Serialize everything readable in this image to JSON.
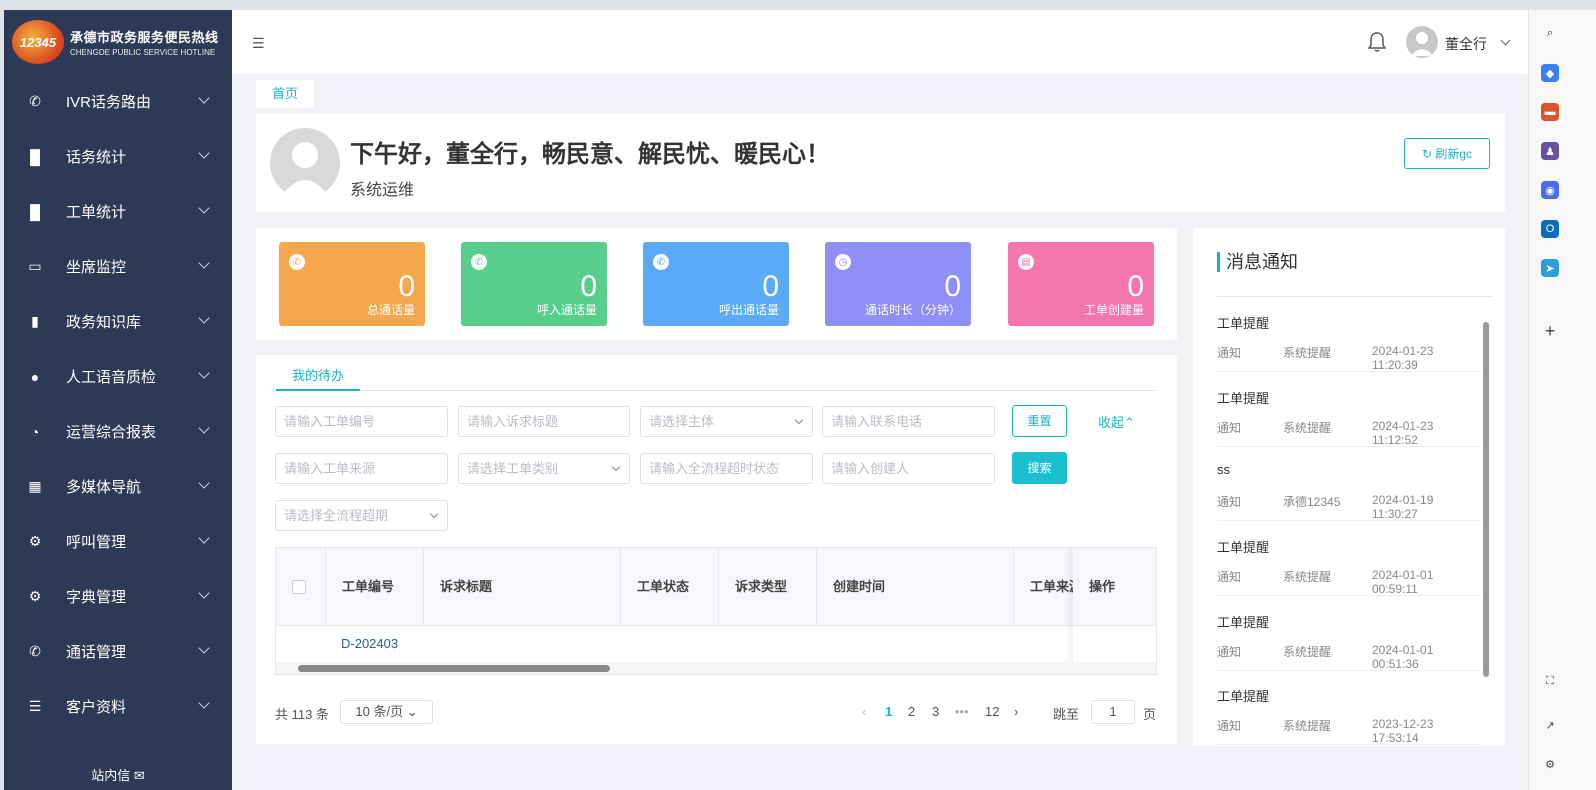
{
  "logo": {
    "mark": "12345",
    "title": "承德市政务服务便民热线",
    "subtitle": "CHENGDE PUBLIC SERVICE HOTLINE"
  },
  "sidebar": {
    "items": [
      {
        "label": "IVR话务路由",
        "icon": "phone-icon"
      },
      {
        "label": "话务统计",
        "icon": "bar-chart-icon"
      },
      {
        "label": "工单统计",
        "icon": "bar-chart-icon"
      },
      {
        "label": "坐席监控",
        "icon": "monitor-icon"
      },
      {
        "label": "政务知识库",
        "icon": "book-icon"
      },
      {
        "label": "人工语音质检",
        "icon": "user-icon"
      },
      {
        "label": "运营综合报表",
        "icon": "pie-chart-icon"
      },
      {
        "label": "多媒体导航",
        "icon": "grid-icon"
      },
      {
        "label": "呼叫管理",
        "icon": "gear-icon"
      },
      {
        "label": "字典管理",
        "icon": "gear-icon"
      },
      {
        "label": "通话管理",
        "icon": "phone-icon"
      },
      {
        "label": "客户资料",
        "icon": "contact-icon"
      }
    ],
    "site_message": "站内信"
  },
  "header": {
    "user_name": "董全行"
  },
  "tags": {
    "home": "首页"
  },
  "welcome": {
    "greeting": "下午好，董全行，畅民意、解民忧、暖民心！",
    "role": "系统运维",
    "refresh_label": "刷新gc"
  },
  "stats": [
    {
      "value": "0",
      "label": "总通话量",
      "color": "#f6a74d"
    },
    {
      "value": "0",
      "label": "呼入通话量",
      "color": "#57cf8b"
    },
    {
      "value": "0",
      "label": "呼出通话量",
      "color": "#5aaaf7"
    },
    {
      "value": "0",
      "label": "通话时长（分钟）",
      "color": "#8e8ff7"
    },
    {
      "value": "0",
      "label": "工单创建量",
      "color": "#f575ad"
    }
  ],
  "todo": {
    "tab": "我的待办",
    "filters": {
      "order_no": "请输入工单编号",
      "title": "请输入诉求标题",
      "subject": "请选择主体",
      "phone": "请输入联系电话",
      "source": "请输入工单来源",
      "category": "请选择工单类别",
      "timeout_status": "请输入全流程超时状态",
      "creator": "请输入创建人",
      "overdue": "请选择全流程超期"
    },
    "reset_label": "重置",
    "search_label": "搜索",
    "collapse_label": "收起",
    "columns": [
      "工单编号",
      "诉求标题",
      "工单状态",
      "诉求类型",
      "创建时间",
      "工单来源",
      "操作"
    ],
    "first_row_id": "D-202403",
    "pagination": {
      "total": "共 113 条",
      "page_size": "10 条/页",
      "pages": [
        "1",
        "2",
        "3",
        "•••",
        "12"
      ],
      "jump_label": "跳至",
      "jump_value": "1",
      "page_unit": "页"
    }
  },
  "notice": {
    "title": "消息通知",
    "items": [
      {
        "title": "工单提醒",
        "type": "通知",
        "source": "系统提醒",
        "time": "2024-01-23 11:20:39"
      },
      {
        "title": "工单提醒",
        "type": "通知",
        "source": "系统提醒",
        "time": "2024-01-23 11:12:52"
      },
      {
        "title": "ss",
        "type": "通知",
        "source": "承德12345",
        "time": "2024-01-19 11:30:27"
      },
      {
        "title": "工单提醒",
        "type": "通知",
        "source": "系统提醒",
        "time": "2024-01-01 00:59:11"
      },
      {
        "title": "工单提醒",
        "type": "通知",
        "source": "系统提醒",
        "time": "2024-01-01 00:51:36"
      },
      {
        "title": "工单提醒",
        "type": "通知",
        "source": "系统提醒",
        "time": "2023-12-23 17:53:14"
      }
    ]
  },
  "colors": {
    "accent": "#1ab3c5",
    "sidebar": "#2d3a55"
  }
}
